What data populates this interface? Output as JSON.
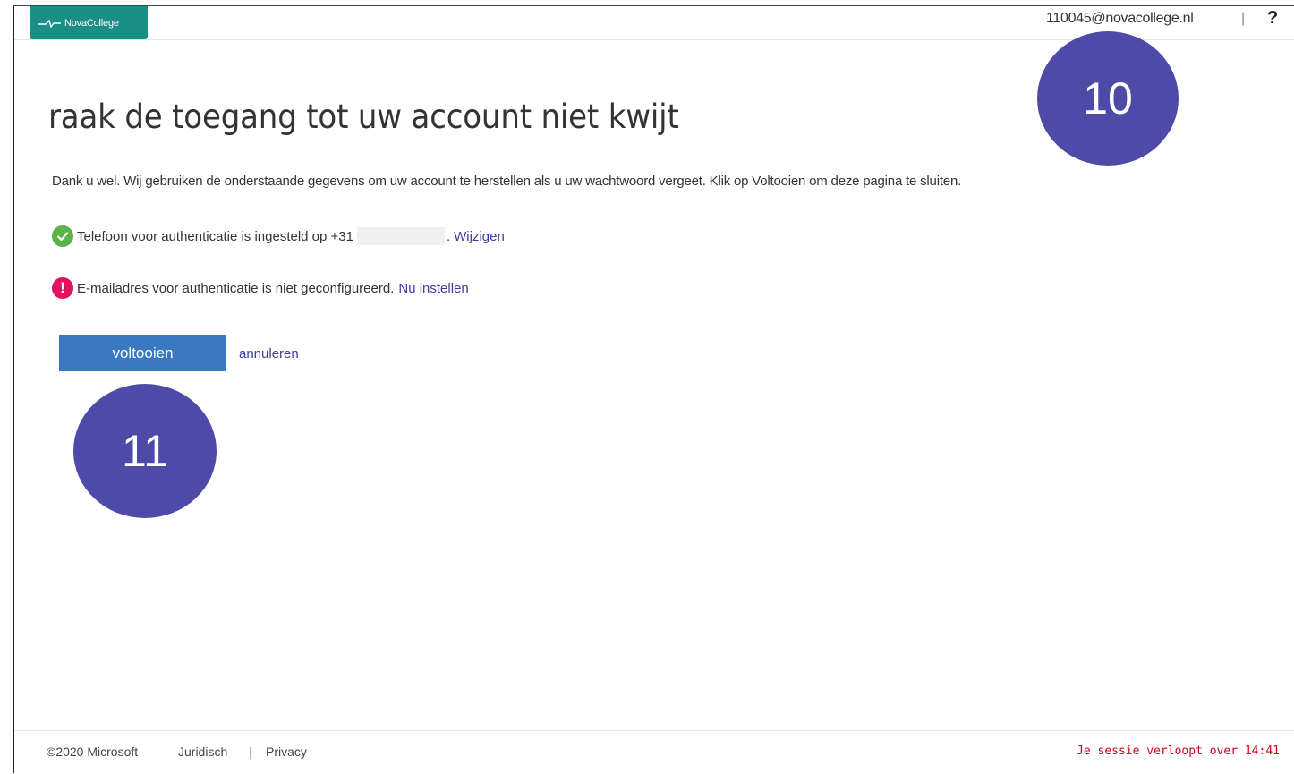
{
  "header": {
    "logo_text": "NovaCollege",
    "user_email": "110045@novacollege.nl",
    "separator": "|",
    "help": "?"
  },
  "main": {
    "title": "raak de toegang tot uw account niet kwijt",
    "intro": "Dank u wel. Wij gebruiken de onderstaande gegevens om uw account te herstellen als u uw wachtwoord vergeet. Klik op Voltooien om deze pagina te sluiten.",
    "phone_status": {
      "text": "Telefoon voor authenticatie is ingesteld op +31",
      "suffix": ".",
      "link": "Wijzigen",
      "status": "ok"
    },
    "email_status": {
      "text": "E-mailadres voor authenticatie is niet geconfigureerd.",
      "link": "Nu instellen",
      "status": "error"
    },
    "finish_button": "voltooien",
    "cancel_link": "annuleren"
  },
  "callouts": [
    "10",
    "11"
  ],
  "footer": {
    "copyright": "©2020 Microsoft",
    "legal": "Juridisch",
    "divider": "|",
    "privacy": "Privacy",
    "session": "Je sessie verloopt over 14:41"
  },
  "colors": {
    "brand": "#1a8f86",
    "primary_button": "#3a78c2",
    "link": "#3d3d9e",
    "ok": "#5bb446",
    "error": "#e0135e",
    "callout": "#4d4aa8",
    "session_warning": "#d0021b"
  }
}
